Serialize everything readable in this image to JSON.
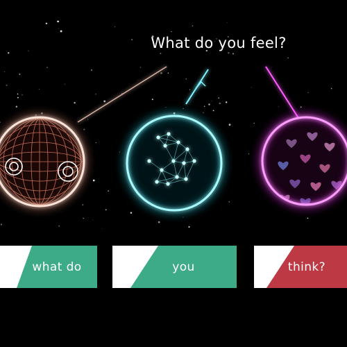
{
  "prompt": "What do you feel?",
  "choices": [
    {
      "label": "what do",
      "color": "#3dab87"
    },
    {
      "label": "you",
      "color": "#3dab87"
    },
    {
      "label": "think?",
      "color": "#bd3a44"
    }
  ],
  "orbs": [
    {
      "name": "orb-emotion-eyes",
      "glow": "#ffd2c4",
      "theme": "wire-sphere-with-eyes"
    },
    {
      "name": "orb-emotion-network",
      "glow": "#7ff6ff",
      "theme": "node-network"
    },
    {
      "name": "orb-emotion-hearts",
      "glow": "#ff5cff",
      "theme": "hearts"
    }
  ],
  "colors": {
    "background": "#000000",
    "choice_base": "#ffffff",
    "text": "#ffffff"
  }
}
